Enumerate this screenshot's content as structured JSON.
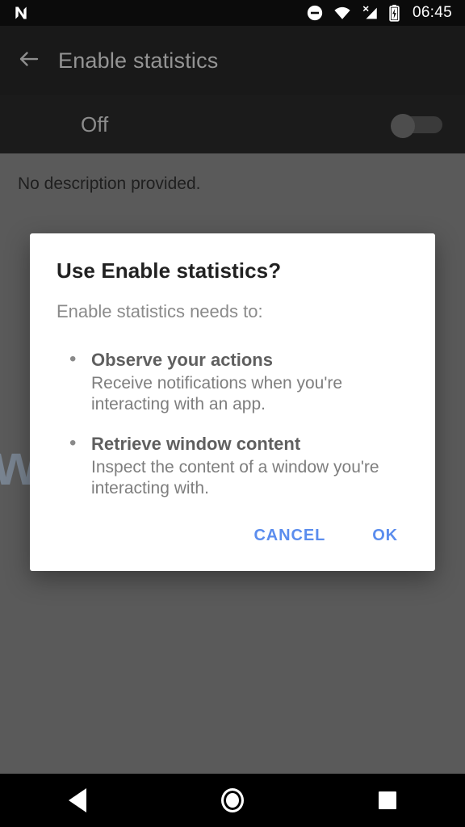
{
  "statusbar": {
    "logo_icon": "android-n-logo",
    "dnd_icon": "do-not-disturb-icon",
    "wifi_icon": "wifi-icon",
    "signal_icon": "cellular-signal-no-service-icon",
    "battery_icon": "battery-charging-icon",
    "clock": "06:45"
  },
  "appbar": {
    "back_icon": "back-arrow-icon",
    "title": "Enable statistics"
  },
  "toggle_row": {
    "label": "Off",
    "switch_state": "off"
  },
  "content": {
    "description": "No description provided."
  },
  "watermark": {
    "text": "we   security"
  },
  "dialog": {
    "title": "Use Enable statistics?",
    "subtitle": "Enable statistics needs to:",
    "bullet_marker": "•",
    "permissions": [
      {
        "title": "Observe your actions",
        "description": "Receive notifications when you're interacting with an app."
      },
      {
        "title": "Retrieve window content",
        "description": "Inspect the content of a window you're interacting with."
      }
    ],
    "cancel_label": "CANCEL",
    "ok_label": "OK",
    "accent_color": "#5b8dee"
  },
  "navbar": {
    "back_icon": "nav-back-triangle-icon",
    "home_icon": "nav-home-circle-icon",
    "recents_icon": "nav-recents-square-icon"
  }
}
